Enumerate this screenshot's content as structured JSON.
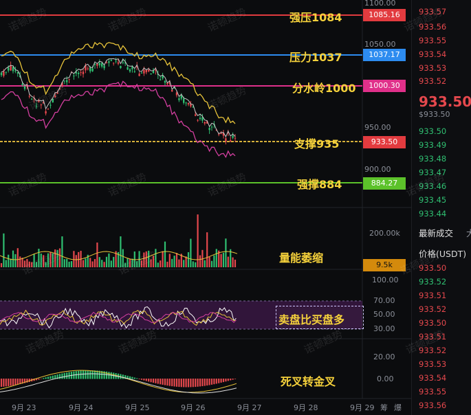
{
  "levels": [
    {
      "id": "strong-resistance",
      "label": "强压1084",
      "tag": "1085.16",
      "color": "#e23b3f"
    },
    {
      "id": "resistance",
      "label": "压力1037",
      "tag": "1037.17",
      "color": "#2d8cf0"
    },
    {
      "id": "watershed",
      "label": "分水岭1000",
      "tag": "1000.30",
      "color": "#e0308a"
    },
    {
      "id": "support",
      "label": "支撑935",
      "tag": "933.50",
      "color": "#d6b13a"
    },
    {
      "id": "strong-support",
      "label": "强撑884",
      "tag": "884.27",
      "color": "#5cc22a"
    }
  ],
  "annotations": {
    "volume": "量能萎缩",
    "rsi": "卖盘比买盘多",
    "macd": "死叉转金叉"
  },
  "volume_tag": "9.5k",
  "price_axis": [
    "1100.00",
    "1050.00",
    "950.00",
    "900.00"
  ],
  "volume_axis": [
    "200.00k",
    "100.00"
  ],
  "rsi_axis": [
    "70.00",
    "50.00",
    "30.00"
  ],
  "macd_axis": [
    "20.00",
    "0.00"
  ],
  "dates": [
    "9月 23",
    "9月 24",
    "9月 25",
    "9月 26",
    "9月 27",
    "9月 28",
    "9月 29",
    "筹",
    "爆"
  ],
  "orderbook": {
    "asks": [
      "933.57",
      "933.56",
      "933.55",
      "933.54",
      "933.53",
      "933.52"
    ],
    "mid_price": "933.50",
    "mid_sub": "$933.50",
    "bids": [
      "933.50",
      "933.49",
      "933.48",
      "933.47",
      "933.46",
      "933.45",
      "933.44"
    ],
    "trades_title": "最新成交",
    "trades_title_cut": "大",
    "price_col": "价格(USDT)",
    "trades": [
      {
        "p": "933.50",
        "c": "red"
      },
      {
        "p": "933.52",
        "c": "green"
      },
      {
        "p": "933.51",
        "c": "red"
      },
      {
        "p": "933.52",
        "c": "red"
      },
      {
        "p": "933.50",
        "c": "red"
      },
      {
        "p": "933.51",
        "c": "red"
      },
      {
        "p": "933.52",
        "c": "red"
      },
      {
        "p": "933.53",
        "c": "red"
      },
      {
        "p": "933.54",
        "c": "red"
      },
      {
        "p": "933.55",
        "c": "red"
      },
      {
        "p": "933.56",
        "c": "red"
      }
    ],
    "top_cut": "933.57"
  },
  "watermark": "诺顿趋势"
}
